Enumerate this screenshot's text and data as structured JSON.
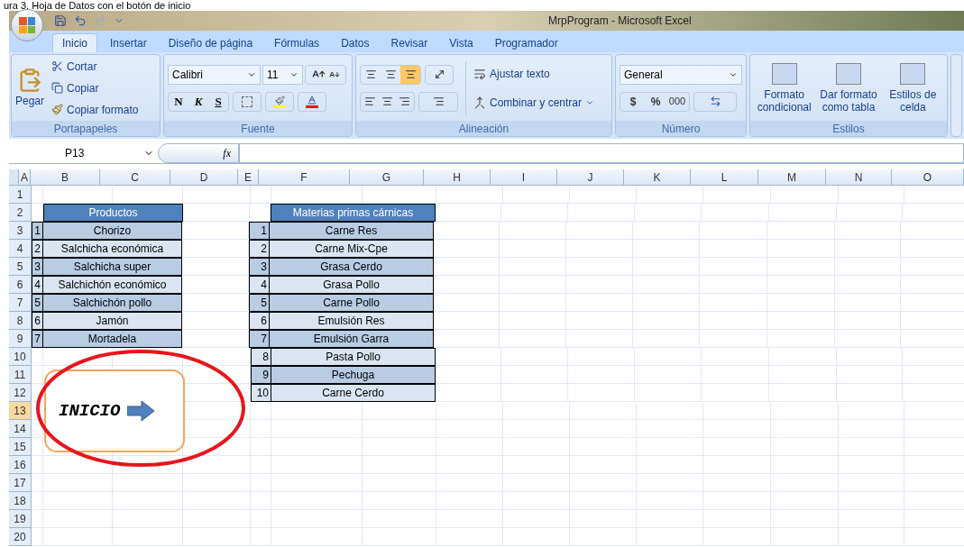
{
  "caption": "ura 3. Hoja de Datos con el botón de inicio",
  "window": {
    "title": "MrpProgram - Microsoft Excel"
  },
  "tabs": [
    {
      "label": "Inicio",
      "selected": true
    },
    {
      "label": "Insertar",
      "selected": false
    },
    {
      "label": "Diseño de página",
      "selected": false
    },
    {
      "label": "Fórmulas",
      "selected": false
    },
    {
      "label": "Datos",
      "selected": false
    },
    {
      "label": "Revisar",
      "selected": false
    },
    {
      "label": "Vista",
      "selected": false
    },
    {
      "label": "Programador",
      "selected": false
    }
  ],
  "ribbon": {
    "clipboard": {
      "paste": "Pegar",
      "cut": "Cortar",
      "copy": "Copiar",
      "format_painter": "Copiar formato",
      "label": "Portapapeles"
    },
    "font": {
      "family": "Calibri",
      "size": "11",
      "bold": "N",
      "italic": "K",
      "underline": "S",
      "label": "Fuente"
    },
    "alignment": {
      "vertical": [
        {
          "selected": false
        },
        {
          "selected": false
        },
        {
          "selected": true
        }
      ],
      "wrap": "Ajustar texto",
      "merge": "Combinar y centrar",
      "label": "Alineación"
    },
    "number": {
      "format": "General",
      "currency": "$",
      "percent": "%",
      "thousands": "000",
      "label": "Número"
    },
    "styles": {
      "buttons": [
        [
          "Formato",
          "condicional"
        ],
        [
          "Dar formato",
          "como tabla"
        ],
        [
          "Estilos de",
          "celda"
        ]
      ],
      "label": "Estilos"
    }
  },
  "formula_bar": {
    "name_box": "P13",
    "function_label": "fx"
  },
  "sheet": {
    "columns": [
      "A",
      "B",
      "C",
      "D",
      "E",
      "F",
      "G",
      "H",
      "I",
      "J",
      "K",
      "L",
      "M",
      "N",
      "O"
    ],
    "rows": [
      {
        "label": "1",
        "selected": false
      },
      {
        "label": "2",
        "selected": false
      },
      {
        "label": "3",
        "selected": false
      },
      {
        "label": "4",
        "selected": false
      },
      {
        "label": "5",
        "selected": false
      },
      {
        "label": "6",
        "selected": false
      },
      {
        "label": "7",
        "selected": false
      },
      {
        "label": "8",
        "selected": false
      },
      {
        "label": "9",
        "selected": false
      },
      {
        "label": "10",
        "selected": false
      },
      {
        "label": "11",
        "selected": false
      },
      {
        "label": "12",
        "selected": false
      },
      {
        "label": "13",
        "selected": true
      },
      {
        "label": "14",
        "selected": false
      },
      {
        "label": "15",
        "selected": false
      },
      {
        "label": "16",
        "selected": false
      },
      {
        "label": "17",
        "selected": false
      },
      {
        "label": "18",
        "selected": false
      },
      {
        "label": "19",
        "selected": false
      },
      {
        "label": "20",
        "selected": false
      }
    ],
    "tables": [
      {
        "header": "Productos",
        "items": [
          {
            "index": "1",
            "name": "Chorizo"
          },
          {
            "index": "2",
            "name": "Salchicha económica"
          },
          {
            "index": "3",
            "name": "Salchicha super"
          },
          {
            "index": "4",
            "name": "Salchichón económico"
          },
          {
            "index": "5",
            "name": "Salchichón pollo"
          },
          {
            "index": "6",
            "name": "Jamón"
          },
          {
            "index": "7",
            "name": "Mortadela"
          }
        ]
      },
      {
        "header": "Materias primas cárnicas",
        "items": [
          {
            "index": "1",
            "name": "Carne Res"
          },
          {
            "index": "2",
            "name": "Carne Mix-Cpe"
          },
          {
            "index": "3",
            "name": "Grasa Cerdo"
          },
          {
            "index": "4",
            "name": "Grasa Pollo"
          },
          {
            "index": "5",
            "name": "Carne Pollo"
          },
          {
            "index": "6",
            "name": "Emulsión Res"
          },
          {
            "index": "7",
            "name": "Emulsión Garra"
          },
          {
            "index": "8",
            "name": "Pasta Pollo"
          },
          {
            "index": "9",
            "name": "Pechuga"
          },
          {
            "index": "10",
            "name": "Carne Cerdo"
          }
        ]
      }
    ],
    "start_button": {
      "label": "INICIO"
    }
  }
}
